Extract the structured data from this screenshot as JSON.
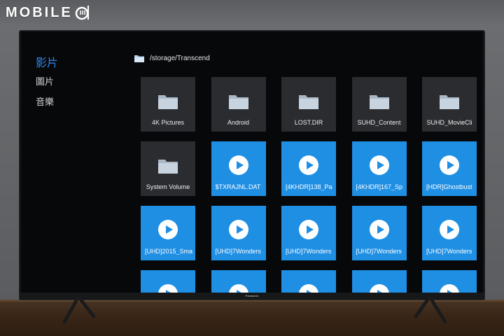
{
  "watermark": {
    "text": "MOBILE"
  },
  "tv_brand": "Panasonic",
  "sidebar": {
    "items": [
      {
        "label": "影片",
        "active": true
      },
      {
        "label": "圖片",
        "active": false
      },
      {
        "label": "音樂",
        "active": false
      }
    ]
  },
  "path": {
    "text": "/storage/Transcend",
    "icon": "folder-icon"
  },
  "grid": {
    "tiles": [
      {
        "type": "folder",
        "label": "4K Pictures"
      },
      {
        "type": "folder",
        "label": "Android"
      },
      {
        "type": "folder",
        "label": "LOST.DIR"
      },
      {
        "type": "folder",
        "label": "SUHD_Content"
      },
      {
        "type": "folder",
        "label": "SUHD_MovieCli"
      },
      {
        "type": "folder",
        "label": "System Volume"
      },
      {
        "type": "video",
        "label": "$TXRAJNL.DAT"
      },
      {
        "type": "video",
        "label": "[4KHDR]138_Pa"
      },
      {
        "type": "video",
        "label": "[4KHDR]167_Sp"
      },
      {
        "type": "video",
        "label": "[HDR]Ghostbust"
      },
      {
        "type": "video",
        "label": "[UHD]2015_Sma"
      },
      {
        "type": "video",
        "label": "[UHD]7Wonders"
      },
      {
        "type": "video",
        "label": "[UHD]7Wonders"
      },
      {
        "type": "video",
        "label": "[UHD]7Wonders"
      },
      {
        "type": "video",
        "label": "[UHD]7Wonders"
      },
      {
        "type": "video",
        "label": ""
      },
      {
        "type": "video",
        "label": ""
      },
      {
        "type": "video",
        "label": ""
      },
      {
        "type": "video",
        "label": ""
      },
      {
        "type": "video",
        "label": ""
      }
    ]
  },
  "colors": {
    "accent": "#2f86e8",
    "video_tile": "#1f8fe4",
    "folder_tile": "#2b2c2f",
    "screen_bg": "#070809"
  }
}
